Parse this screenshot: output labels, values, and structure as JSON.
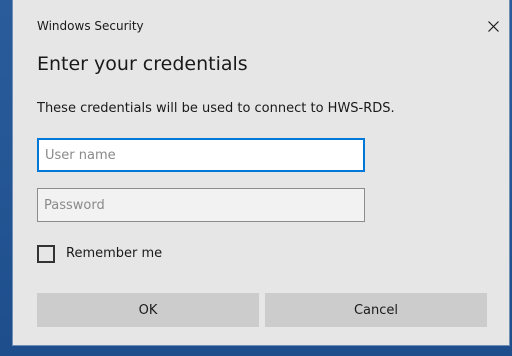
{
  "window": {
    "title": "Windows Security",
    "close_icon": "close-icon"
  },
  "dialog": {
    "heading": "Enter your credentials",
    "message": "These credentials will be used to connect to HWS-RDS."
  },
  "form": {
    "username": {
      "value": "",
      "placeholder": "User name"
    },
    "password": {
      "value": "",
      "placeholder": "Password"
    },
    "remember_me": {
      "label": "Remember me",
      "checked": false
    }
  },
  "buttons": {
    "ok_label": "OK",
    "cancel_label": "Cancel"
  },
  "colors": {
    "accent": "#0078d7",
    "dialog_bg": "#e6e6e6",
    "button_bg": "#cccccc"
  }
}
